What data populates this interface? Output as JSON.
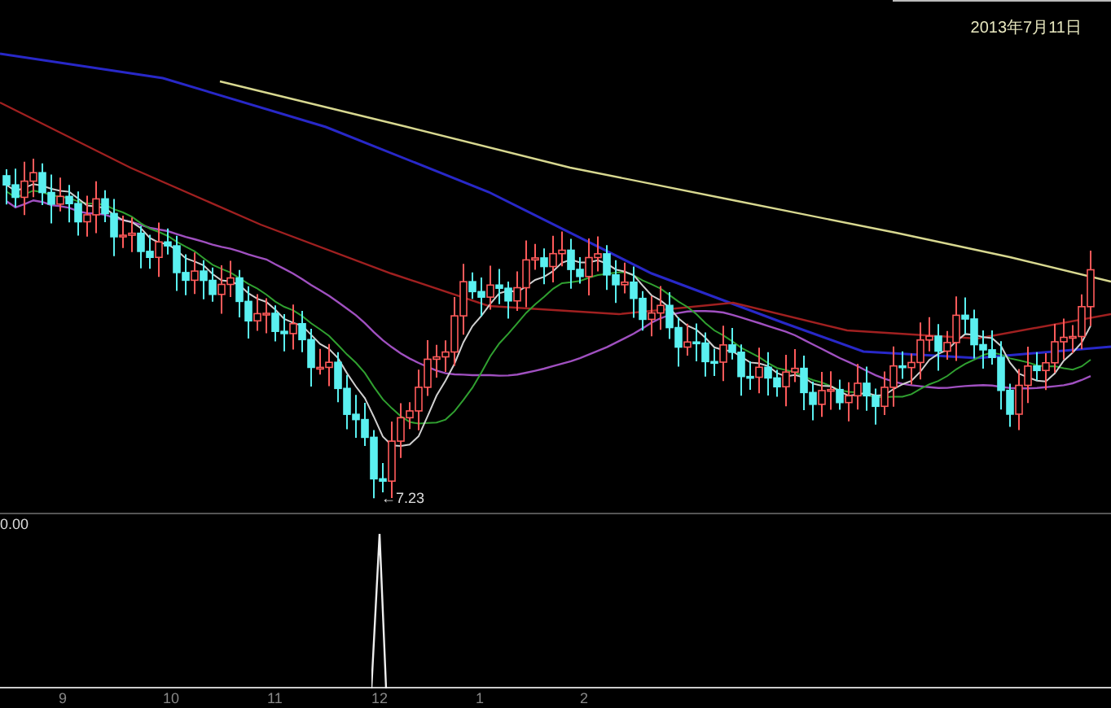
{
  "price_panel": {
    "date": "2013年7月11日",
    "low_marker": "←7.23"
  },
  "indicator_panel": {
    "value": "0.00"
  },
  "x_axis": {
    "labels": [
      "9",
      "10",
      "11",
      "12",
      "1",
      "2"
    ]
  }
}
